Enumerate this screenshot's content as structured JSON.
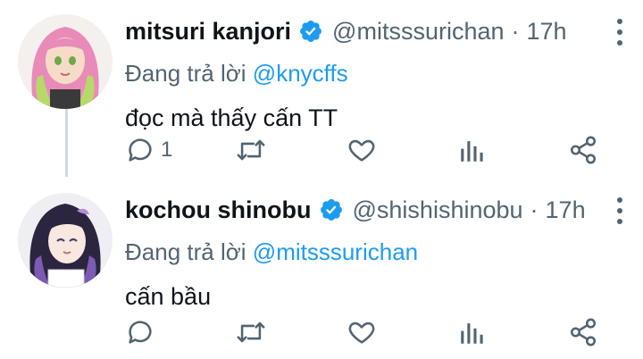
{
  "tweets": [
    {
      "display_name": "mitsuri kanjori",
      "handle": "@mitsssurichan",
      "separator": "·",
      "time": "17h",
      "replying_prefix": "Đang trả lời",
      "replying_to": "@knycffs",
      "text": "đọc mà thấy cấn TT",
      "reply_count": "1",
      "avatar_palette": {
        "hair": "#e98bb8",
        "hair_tip": "#b7d96a",
        "skin": "#f6dcc8",
        "bg": "#f4f0ee"
      }
    },
    {
      "display_name": "kochou shinobu",
      "handle": "@shishishinobu",
      "separator": "·",
      "time": "17h",
      "replying_prefix": "Đang trả lời",
      "replying_to": "@mitsssurichan",
      "text": "cấn bầu",
      "reply_count": "",
      "avatar_palette": {
        "hair": "#2b2540",
        "hair_tip": "#7b5bb3",
        "skin": "#f8e8df",
        "bg": "#efeef3"
      }
    }
  ],
  "colors": {
    "accent": "#1d9bf0",
    "muted": "#536471",
    "text": "#0f1419",
    "thread_line": "#cfd9de"
  },
  "icons": [
    "verified-badge-icon",
    "more-vertical-icon",
    "reply-icon",
    "retweet-icon",
    "like-icon",
    "analytics-icon",
    "share-icon"
  ]
}
